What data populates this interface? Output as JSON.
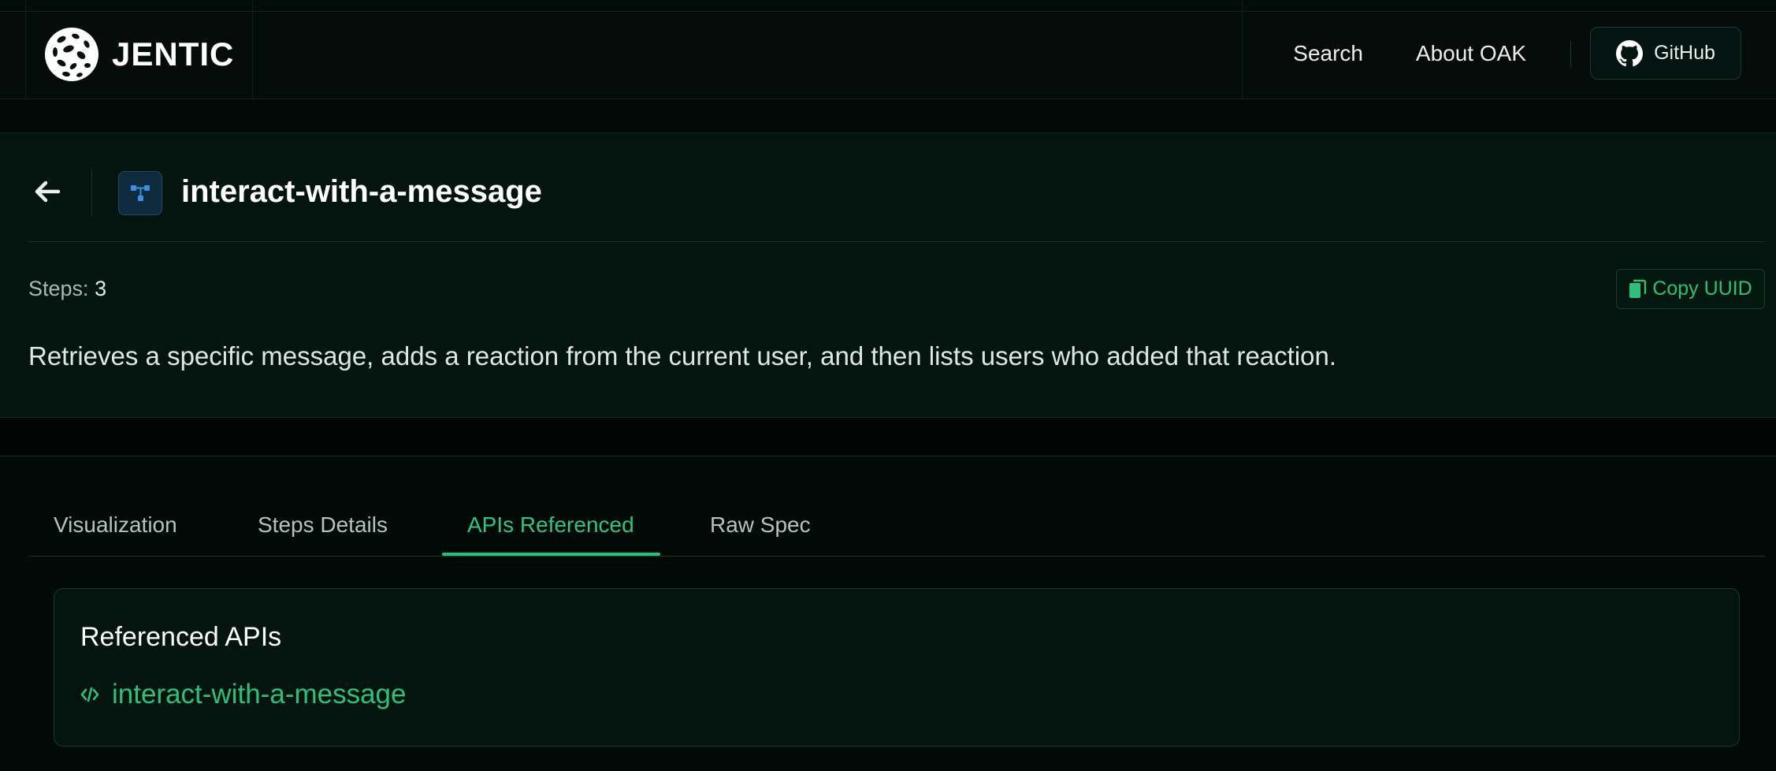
{
  "header": {
    "brand": "JENTIC",
    "nav": {
      "search": "Search",
      "about": "About OAK",
      "github": "GitHub"
    }
  },
  "workflow": {
    "title": "interact-with-a-message",
    "steps_label": "Steps:",
    "steps_value": "3",
    "copy_uuid": "Copy UUID",
    "description": "Retrieves a specific message, adds a reaction from the current user, and then lists users who added that reaction."
  },
  "tabs": [
    {
      "label": "Visualization",
      "active": false
    },
    {
      "label": "Steps Details",
      "active": false
    },
    {
      "label": "APIs Referenced",
      "active": true
    },
    {
      "label": "Raw Spec",
      "active": false
    }
  ],
  "referenced": {
    "title": "Referenced APIs",
    "apis": [
      "interact-with-a-message"
    ]
  },
  "colors": {
    "accent": "#2fbf7c",
    "background": "#020a08",
    "panel": "#04150f",
    "icon_blue": "#3b8fe0"
  },
  "icons": {
    "logo": "jentic-logo-icon",
    "github": "github-icon",
    "back": "arrow-left-icon",
    "workflow": "workflow-icon",
    "copy": "copy-icon",
    "api": "code-icon"
  }
}
